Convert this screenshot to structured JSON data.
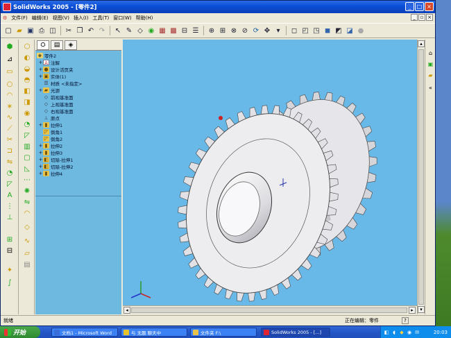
{
  "window": {
    "title": "SolidWorks 2005 - [零件2]",
    "controls": [
      "minimize",
      "maximize",
      "close"
    ]
  },
  "menubar": {
    "items": [
      "文件(F)",
      "编辑(E)",
      "视图(V)",
      "插入(I)",
      "工具(T)",
      "窗口(W)",
      "帮助(H)"
    ]
  },
  "toolbar": {
    "icons": [
      "new-icon",
      "open-icon",
      "save-icon",
      "print-icon",
      "print-preview-icon",
      "cut-icon",
      "copy-icon",
      "undo-icon",
      "redo-icon",
      "select-icon",
      "sketch-icon",
      "smart-dimension-icon",
      "rebuild-icon",
      "options-icon",
      "feature-icon",
      "zoom-fit-icon",
      "zoom-area-icon",
      "zoom-in-out-icon",
      "rotate-icon",
      "pan-icon",
      "view-orientation-icon",
      "wireframe-icon",
      "hidden-lines-icon",
      "shaded-icon",
      "section-view-icon"
    ]
  },
  "feature_tree": {
    "root": "零件2",
    "items": [
      {
        "label": "注解",
        "icon": "annotations-icon",
        "expandable": true
      },
      {
        "label": "设计活页夹",
        "icon": "design-binder-icon",
        "expandable": true
      },
      {
        "label": "实体(1)",
        "icon": "solid-bodies-icon",
        "expandable": true
      },
      {
        "label": "材质 <未指定>",
        "icon": "material-icon",
        "expandable": false
      },
      {
        "label": "光源",
        "icon": "lights-icon",
        "expandable": true
      },
      {
        "label": "前视基准面",
        "icon": "plane-icon",
        "expandable": false
      },
      {
        "label": "上视基准面",
        "icon": "plane-icon",
        "expandable": false
      },
      {
        "label": "右视基准面",
        "icon": "plane-icon",
        "expandable": false
      },
      {
        "label": "原点",
        "icon": "origin-icon",
        "expandable": false
      },
      {
        "label": "拉伸1",
        "icon": "extrude-icon",
        "expandable": true
      },
      {
        "label": "倒角1",
        "icon": "chamfer-icon",
        "expandable": false
      },
      {
        "label": "倒角2",
        "icon": "chamfer-icon",
        "expandable": false
      },
      {
        "label": "拉伸2",
        "icon": "extrude-icon",
        "expandable": true
      },
      {
        "label": "拉伸3",
        "icon": "extrude-icon",
        "expandable": true
      },
      {
        "label": "切除-拉伸1",
        "icon": "cut-extrude-icon",
        "expandable": true
      },
      {
        "label": "切除-拉伸2",
        "icon": "cut-extrude-icon",
        "expandable": true
      },
      {
        "label": "拉伸4",
        "icon": "extrude-icon",
        "expandable": true
      }
    ]
  },
  "statusbar": {
    "left": "就绪",
    "right": "正在编辑：零件",
    "help": "?"
  },
  "taskbar": {
    "start": "开始",
    "tasks": [
      {
        "label": "文档1 - Microsoft Word",
        "active": false
      },
      {
        "label": "与 无题 聊天中",
        "active": false
      },
      {
        "label": "文件夹 F:\\",
        "active": false
      },
      {
        "label": "SolidWorks 2005 - [...]",
        "active": true
      }
    ],
    "clock": "20:03"
  },
  "colors": {
    "viewport_bg": "#68b8e8",
    "tree_bg": "#6eb9e0",
    "titlebar": "#0a4fd6",
    "gear_face": "#e8e8e8"
  }
}
